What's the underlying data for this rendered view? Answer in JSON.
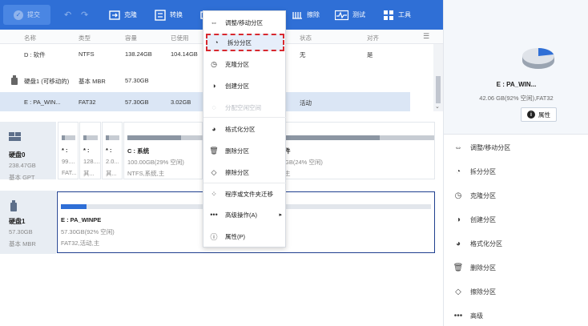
{
  "toolbar": {
    "submit": "提交",
    "items": [
      "克隆",
      "转换",
      "擦除",
      "测试",
      "工具"
    ]
  },
  "table": {
    "headers": [
      "名称",
      "类型",
      "容量",
      "已使用",
      "状态",
      "对齐"
    ],
    "rows": [
      {
        "name": "D : 软件",
        "type": "NTFS",
        "cap": "138.24GB",
        "used": "104.14GB",
        "status": "无",
        "align": "是"
      },
      {
        "name": "硬盘1 (可移动的)",
        "type": "基本 MBR",
        "cap": "57.30GB",
        "used": "",
        "status": "",
        "align": ""
      },
      {
        "name": "E : PA_WIN...",
        "type": "FAT32",
        "cap": "57.30GB",
        "used": "3.02GB",
        "status": "活动",
        "align": ""
      }
    ]
  },
  "disks": [
    {
      "name": "硬盘0",
      "size": "238.47GB",
      "type": "基本 GPT",
      "parts": [
        {
          "label": "* :",
          "l1": "99....",
          "l2": "FAT..."
        },
        {
          "label": "* :",
          "l1": "128....",
          "l2": "其..."
        },
        {
          "label": "* :",
          "l1": "2.0...",
          "l2": "其..."
        },
        {
          "label": "C : 系统",
          "l1": "100.00GB(29% 空闲)",
          "l2": "NTFS,系统,主"
        },
        {
          "label": "件",
          "l1": "GB(24% 空闲)",
          "l2": "主"
        }
      ]
    },
    {
      "name": "硬盘1",
      "size": "57.30GB",
      "type": "基本 MBR",
      "parts": [
        {
          "label": "E : PA_WINPE",
          "l1": "57.30GB(92% 空闲)",
          "l2": "FAT32,活动,主"
        }
      ]
    }
  ],
  "context_menu": [
    {
      "label": "调整/移动分区",
      "icon": "resize-icon",
      "disabled": false
    },
    {
      "label": "拆分分区",
      "icon": "split-icon",
      "disabled": false,
      "highlighted": true
    },
    {
      "label": "克隆分区",
      "icon": "clone-icon",
      "disabled": false
    },
    {
      "label": "创建分区",
      "icon": "create-icon",
      "disabled": false
    },
    {
      "label": "分配空闲空间",
      "icon": "allocate-icon",
      "disabled": true
    },
    {
      "label": "格式化分区",
      "icon": "format-icon",
      "disabled": false
    },
    {
      "label": "删除分区",
      "icon": "trash-icon",
      "disabled": false
    },
    {
      "label": "擦除分区",
      "icon": "eraser-icon",
      "disabled": false
    },
    {
      "label": "程序或文件夹迁移",
      "icon": "migrate-icon",
      "disabled": false
    },
    {
      "label": "高级操作(A)",
      "icon": "more-icon",
      "disabled": false,
      "submenu": true
    },
    {
      "label": "属性(P)",
      "icon": "info-icon",
      "disabled": false
    }
  ],
  "right_panel": {
    "title": "E : PA_WIN...",
    "subtitle": "42.06 GB(92% 空闲),FAT32",
    "properties": "属性",
    "actions": [
      "调整/移动分区",
      "拆分分区",
      "克隆分区",
      "创建分区",
      "格式化分区",
      "删除分区",
      "擦除分区",
      "高级"
    ]
  },
  "colors": {
    "accent": "#2f6fd6",
    "selection": "#dbe6f5",
    "highlight_border": "#d8292f"
  }
}
